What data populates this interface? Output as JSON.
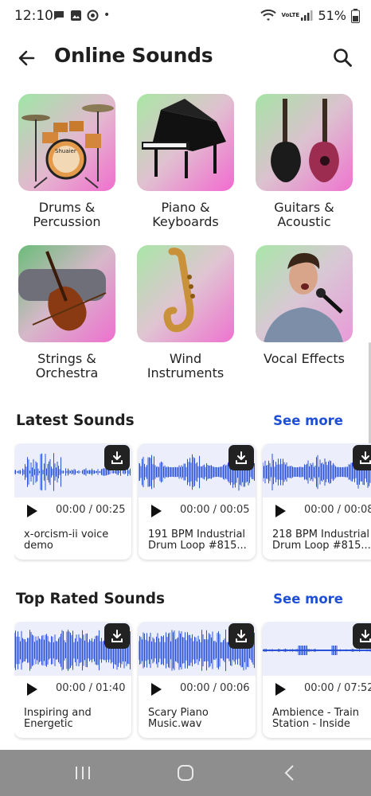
{
  "status_bar": {
    "time": "12:10",
    "dot": "•",
    "network_label": "VoLTE",
    "battery": "51%"
  },
  "header": {
    "title": "Online Sounds"
  },
  "categories": [
    {
      "label": "Drums & Percussion",
      "icon": "drums-image"
    },
    {
      "label": "Piano & Keyboards",
      "icon": "piano-image"
    },
    {
      "label": "Guitars & Acoustic",
      "icon": "guitars-image"
    },
    {
      "label": "Strings & Orchestra",
      "icon": "violin-image"
    },
    {
      "label": "Wind Instruments",
      "icon": "saxophone-image"
    },
    {
      "label": "Vocal Effects",
      "icon": "singer-image"
    }
  ],
  "latest": {
    "title": "Latest Sounds",
    "see_more": "See more",
    "items": [
      {
        "duration": "00:00 / 00:25",
        "title": "x-orcism-ii voice demo"
      },
      {
        "duration": "00:00 / 00:05",
        "title": "191 BPM Industrial Drum Loop #815..."
      },
      {
        "duration": "00:00 / 00:08",
        "title": "218 BPM Industrial Drum Loop #815..."
      }
    ]
  },
  "top_rated": {
    "title": "Top Rated Sounds",
    "see_more": "See more",
    "items": [
      {
        "duration": "00:00 / 01:40",
        "title": "Inspiring and Energetic"
      },
      {
        "duration": "00:00 / 00:06",
        "title": "Scary Piano Music.wav"
      },
      {
        "duration": "00:00 / 07:52",
        "title": "Ambience - Train Station - Inside"
      }
    ]
  },
  "colors": {
    "accent": "#1f4fd6",
    "waveform": "#2a52d8",
    "wave_bg": "#eceffb",
    "nav_bar": "#8e8e8e"
  }
}
